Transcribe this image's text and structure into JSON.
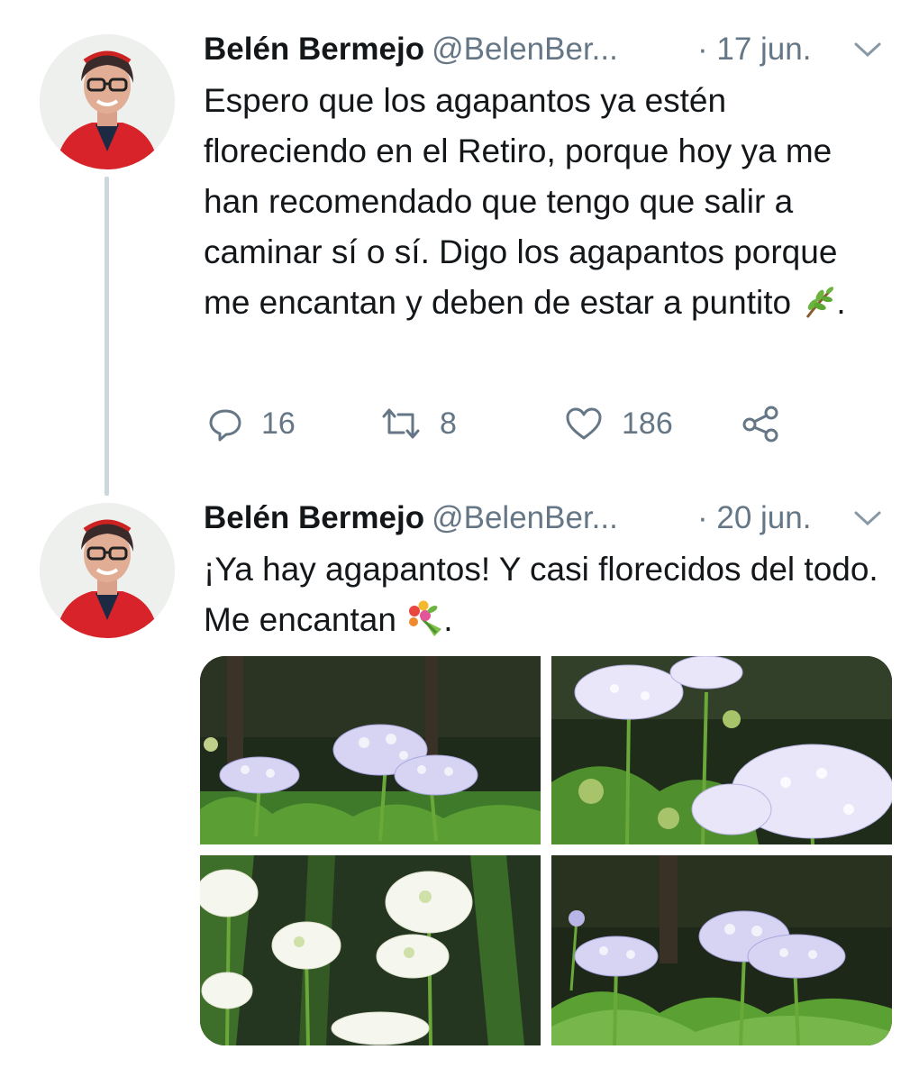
{
  "tweets": [
    {
      "name": "Belén Bermejo",
      "handle": "@BelenBer...",
      "date": "· 17 jun.",
      "text": "Espero que los agapantos ya estén floreciendo en el Retiro, porque hoy ya me han recomendado que tengo que salir a caminar sí o sí. Digo los agapantos porque me encantan y deben de estar a puntito",
      "text_end": ".",
      "emoji": "herb-emoji",
      "replies": "16",
      "retweets": "8",
      "likes": "186"
    },
    {
      "name": "Belén Bermejo",
      "handle": "@BelenBer...",
      "date": "· 20 jun.",
      "text": "¡Ya hay agapantos! Y casi florecidos del todo. Me encantan",
      "text_end": ".",
      "emoji": "bouquet-emoji",
      "photos": [
        "agapanthus-photo-1",
        "agapanthus-photo-2",
        "agapanthus-photo-3",
        "agapanthus-photo-4"
      ]
    }
  ],
  "colors": {
    "text": "#14171a",
    "secondary": "#657786",
    "thread_line": "#ccd6dd",
    "avatar_jacket": "#d8232a"
  },
  "icons": [
    "reply-icon",
    "retweet-icon",
    "like-icon",
    "share-icon",
    "chevron-down-icon"
  ]
}
